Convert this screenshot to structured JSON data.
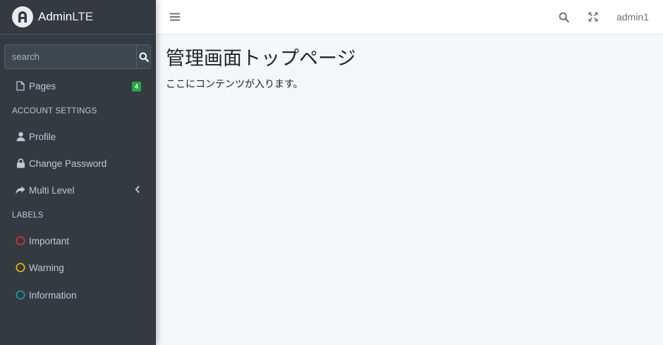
{
  "brand": {
    "name_strong": "Admin",
    "name_light": "LTE"
  },
  "sidebar": {
    "search_placeholder": "search",
    "items": [
      {
        "label": "Pages",
        "badge": "4",
        "icon": "file-icon"
      },
      {
        "header": "ACCOUNT SETTINGS"
      },
      {
        "label": "Profile",
        "icon": "user-icon"
      },
      {
        "label": "Change Password",
        "icon": "lock-icon"
      },
      {
        "label": "Multi Level",
        "icon": "share-icon"
      },
      {
        "header": "LABELS"
      },
      {
        "label": "Important",
        "icon": "circle-icon",
        "color": "#dc3545"
      },
      {
        "label": "Warning",
        "icon": "circle-icon",
        "color": "#ffc107"
      },
      {
        "label": "Information",
        "icon": "circle-icon",
        "color": "#17a2b8"
      }
    ]
  },
  "navbar": {
    "user": "admin1"
  },
  "main": {
    "title": "管理画面トップページ",
    "text": "ここにコンテンツが入ります。"
  },
  "colors": {
    "sidebar_bg": "#343a40",
    "content_bg": "#f4f6f9",
    "badge_green": "#28a745"
  }
}
